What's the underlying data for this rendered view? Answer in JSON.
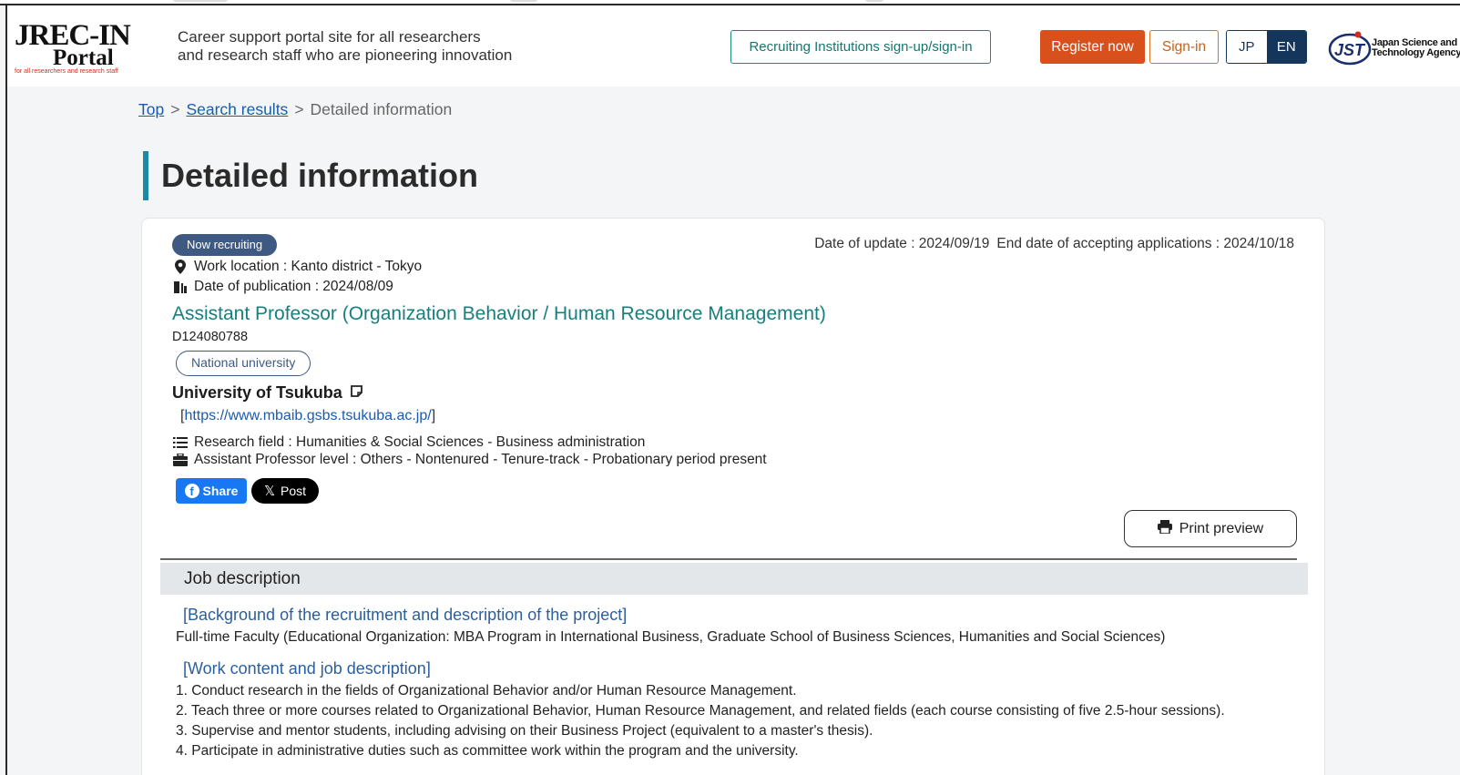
{
  "header": {
    "logo_line1": "JREC-IN",
    "logo_line2": "Portal",
    "logo_subtitle": "for all researchers and research staff",
    "tagline_line1": "Career support portal site for all researchers",
    "tagline_line2": "and research staff who are pioneering innovation",
    "institutions_button": "Recruiting Institutions sign-up/sign-in",
    "register_button": "Register now",
    "signin_button": "Sign-in",
    "lang_jp": "JP",
    "lang_en": "EN",
    "jst_line1": "Japan Science and",
    "jst_line2": "Technology Agency"
  },
  "breadcrumb": {
    "top": "Top",
    "search_results": "Search results",
    "current": "Detailed information",
    "separator": ">"
  },
  "page_title": "Detailed information",
  "job": {
    "status": "Now recruiting",
    "date_of_update": "Date of update : 2024/09/19",
    "end_date": "End date of accepting applications : 2024/10/18",
    "work_location": "Work location : Kanto district - Tokyo",
    "publication_date": "Date of publication : 2024/08/09",
    "title": "Assistant Professor (Organization Behavior / Human Resource Management)",
    "id": "D124080788",
    "institution_type": "National university",
    "institution_name": "University of Tsukuba",
    "url_bracket_open": "[",
    "url": "https://www.mbaib.gsbs.tsukuba.ac.jp/",
    "url_bracket_close": "]",
    "research_field": "Research field : Humanities & Social Sciences - Business administration",
    "position_level": "Assistant Professor level : Others - Nontenured - Tenure-track - Probationary period present"
  },
  "share": {
    "facebook": "Share",
    "x": "Post"
  },
  "print_preview": "Print preview",
  "job_description": {
    "heading": "Job description",
    "background_heading": "[Background of the recruitment and description of the project]",
    "background_text": "Full-time Faculty (Educational Organization: MBA Program in International Business, Graduate School of Business Sciences, Humanities and Social Sciences)",
    "work_heading": "[Work content and job description]",
    "work_items": [
      "1. Conduct research in the fields of Organizational Behavior and/or Human Resource Management.",
      "2. Teach three or more courses related to Organizational Behavior, Human Resource Management, and related fields (each course consisting of five 2.5-hour sessions).",
      "3. Supervise and mentor students, including advising on their Business Project (equivalent to a master's thesis).",
      "4. Participate in administrative duties such as committee work within the program and the university."
    ]
  },
  "colors": {
    "accent_teal": "#17807d",
    "register_orange": "#d8501c",
    "navy": "#14365a",
    "title_bar": "#1d8aa5"
  }
}
